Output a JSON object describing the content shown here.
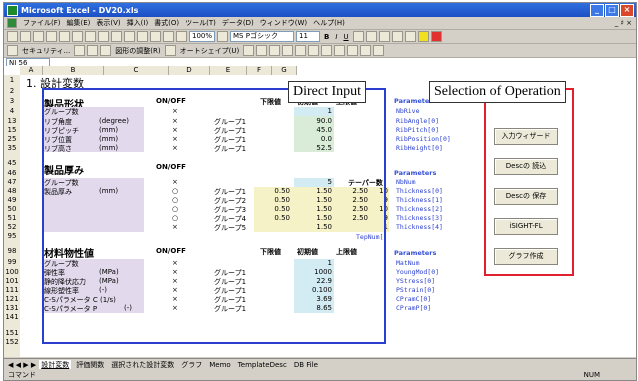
{
  "window": {
    "title": "Microsoft Excel - DV20.xls"
  },
  "menu": [
    "ファイル(F)",
    "編集(E)",
    "表示(V)",
    "挿入(I)",
    "書式(O)",
    "ツール(T)",
    "データ(D)",
    "ウィンドウ(W)",
    "ヘルプ(H)"
  ],
  "menu_right": "_ ♯ ×",
  "toolbar": {
    "zoom": "100%",
    "font": "MS Pゴシック",
    "size": "11",
    "bold": "B",
    "italic": "I",
    "underline": "U",
    "security": "セキュリティ...",
    "autoshape": "オートシェイプ(U)",
    "draw": "図形の調整(R)"
  },
  "namebox": "NI 56",
  "columns": [
    "A",
    "B",
    "C",
    "D",
    "E",
    "F",
    "G"
  ],
  "rows": [
    "1",
    "2",
    "3",
    "4",
    "13",
    "15",
    "25",
    "35",
    "45",
    "46",
    "47",
    "48",
    "49",
    "50",
    "51",
    "52",
    "95",
    "98",
    "99",
    "100",
    "101",
    "111",
    "121",
    "131",
    "141",
    "151",
    "152"
  ],
  "title": "1. 設計変数",
  "section1": {
    "name": "製品形状",
    "onoff": "ON/OFF",
    "lower": "下限値",
    "initial": "初期値",
    "upper": "上限値",
    "rows": [
      {
        "label": "グループ数",
        "unit": "",
        "mark": "×",
        "grp": "",
        "init": "1"
      },
      {
        "label": "リブ角度",
        "unit": "(degree)",
        "mark": "×",
        "grp": "グループ1",
        "init": "90.0"
      },
      {
        "label": "リブピッチ",
        "unit": "(mm)",
        "mark": "×",
        "grp": "グループ1",
        "init": "45.0"
      },
      {
        "label": "リブ位置",
        "unit": "(mm)",
        "mark": "×",
        "grp": "グループ1",
        "init": "0.0"
      },
      {
        "label": "リブ高さ",
        "unit": "(mm)",
        "mark": "×",
        "grp": "グループ1",
        "init": "52.5"
      }
    ],
    "params_header": "Parameters",
    "params": [
      "NbRive",
      "RibAngle[0]",
      "RibPitch[0]",
      "RibPosition[0]",
      "RibHeight[0]"
    ]
  },
  "section2": {
    "name": "製品厚み",
    "onoff": "ON/OFF",
    "taper": "テーパー数",
    "group_count": {
      "label": "グループ数",
      "mark": "×",
      "init": "5"
    },
    "label": "製品厚み",
    "unit": "(mm)",
    "rows": [
      {
        "mark": "○",
        "grp": "グループ1",
        "lower": "0.50",
        "init": "1.50",
        "upper": "2.50",
        "taper": "10"
      },
      {
        "mark": "○",
        "grp": "グループ2",
        "lower": "0.50",
        "init": "1.50",
        "upper": "2.50",
        "taper": "9"
      },
      {
        "mark": "○",
        "grp": "グループ3",
        "lower": "0.50",
        "init": "1.50",
        "upper": "2.50",
        "taper": "10"
      },
      {
        "mark": "○",
        "grp": "グループ4",
        "lower": "0.50",
        "init": "1.50",
        "upper": "2.50",
        "taper": "9"
      },
      {
        "mark": "×",
        "grp": "グループ5",
        "lower": "",
        "init": "1.50",
        "upper": "",
        "taper": "1"
      }
    ],
    "taper_param": "TepNum[]",
    "params_header": "Parameters",
    "params": [
      "NbNum",
      "Thickness[0]",
      "Thickness[1]",
      "Thickness[2]",
      "Thickness[3]",
      "Thickness[4]"
    ]
  },
  "section3": {
    "name": "材料物性値",
    "onoff": "ON/OFF",
    "lower": "下限値",
    "initial": "初期値",
    "upper": "上限値",
    "rows": [
      {
        "label": "グループ数",
        "unit": "",
        "mark": "×",
        "grp": "",
        "init": "1"
      },
      {
        "label": "弾性率",
        "unit": "(MPa)",
        "mark": "×",
        "grp": "グループ1",
        "init": "1000"
      },
      {
        "label": "静的降伏応力",
        "unit": "(MPa)",
        "mark": "×",
        "grp": "グループ1",
        "init": "22.9"
      },
      {
        "label": "線形塑性率",
        "unit": "(-)",
        "mark": "×",
        "grp": "グループ1",
        "init": "0.100"
      },
      {
        "label": "C-Sパラメータ C (1/s)",
        "unit": "",
        "mark": "×",
        "grp": "グループ1",
        "init": "3.69"
      },
      {
        "label": "C-Sパラメータ P",
        "unit": "(-)",
        "mark": "×",
        "grp": "グループ1",
        "init": "8.65"
      }
    ],
    "params_header": "Parameters",
    "params": [
      "MatNum",
      "YoungMod[0]",
      "YStress[0]",
      "PStrain[0]",
      "CPramC[0]",
      "CPramP[0]"
    ]
  },
  "buttons": [
    "入力ウィザード",
    "Descの 読込",
    "Descの 保存",
    "iSIGHT-FL",
    "グラフ作成"
  ],
  "callouts": {
    "direct": "Direct Input",
    "operation": "Selection of Operation"
  },
  "sheet_tabs": [
    "設計変数",
    "評価関数",
    "選択された設計変数",
    "グラフ",
    "Memo",
    "TemplateDesc",
    "DB File"
  ],
  "status": {
    "mode": "コマンド",
    "num": "NUM"
  }
}
